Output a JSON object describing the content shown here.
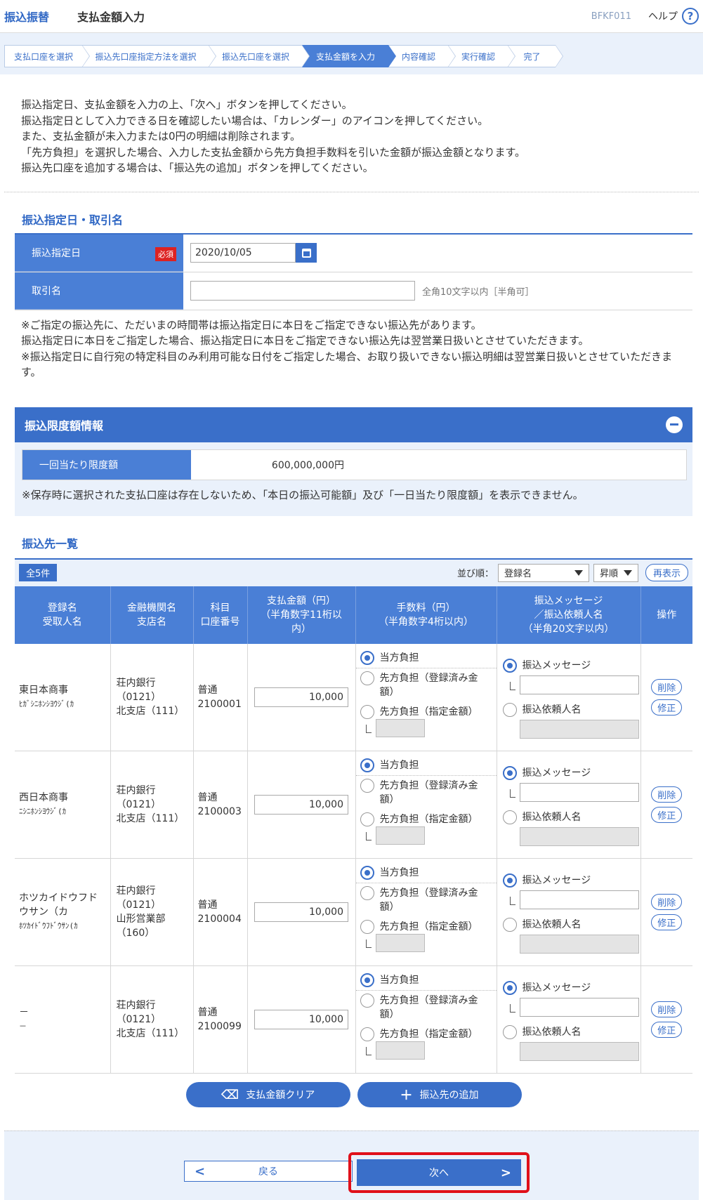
{
  "header": {
    "category": "振込振替",
    "title": "支払金額入力",
    "screen_code": "BFKF011",
    "help_label": "ヘルプ"
  },
  "steps": [
    "支払口座を選択",
    "振込先口座指定方法を選択",
    "振込先口座を選択",
    "支払金額を入力",
    "内容確認",
    "実行確認",
    "完了"
  ],
  "intro": [
    "振込指定日、支払金額を入力の上、「次へ」ボタンを押してください。",
    "振込指定日として入力できる日を確認したい場合は、「カレンダー」のアイコンを押してください。",
    "また、支払金額が未入力または0円の明細は削除されます。",
    "「先方負担」を選択した場合、入力した支払金額から先方負担手数料を引いた金額が振込金額となります。",
    "振込先口座を追加する場合は、「振込先の追加」ボタンを押してください。"
  ],
  "date_section": {
    "title": "振込指定日・取引名",
    "date_label": "振込指定日",
    "required": "必須",
    "date_value": "2020/10/05",
    "name_label": "取引名",
    "name_hint": "全角10文字以内［半角可］",
    "notes": [
      "※ご指定の振込先に、ただいまの時間帯は振込指定日に本日をご指定できない振込先があります。",
      "振込指定日に本日をご指定した場合、振込指定日に本日をご指定できない振込先は翌営業日扱いとさせていただきます。",
      "※振込指定日に自行宛の特定科目のみ利用可能な日付をご指定した場合、お取り扱いできない振込明細は翌営業日扱いとさせていただきます。"
    ]
  },
  "limit": {
    "title": "振込限度額情報",
    "label": "一回当たり限度額",
    "value": "600,000,000円",
    "note": "※保存時に選択された支払口座は存在しないため、「本日の振込可能額」及び「一日当たり限度額」を表示できません。"
  },
  "list": {
    "title": "振込先一覧",
    "count": "全5件",
    "sort_label": "並び順：",
    "sort_value": "登録名",
    "order_value": "昇順",
    "redisplay": "再表示",
    "headers": {
      "name1": "登録名",
      "name2": "受取人名",
      "bank1": "金融機関名",
      "bank2": "支店名",
      "acct1": "科目",
      "acct2": "口座番号",
      "amt1": "支払金額（円）",
      "amt2": "（半角数字11桁以",
      "amt3": "内）",
      "fee1": "手数料（円）",
      "fee2": "（半角数字4桁以内）",
      "msg1": "振込メッセージ",
      "msg2": "／振込依頼人名",
      "msg3": "（半角20文字以内）",
      "ops": "操作"
    },
    "fee_options": {
      "ours": "当方負担",
      "theirs_reg1": "先方負担（登録済み金",
      "theirs_reg2": "額）",
      "theirs_spec": "先方負担（指定金額）"
    },
    "msg_options": {
      "message": "振込メッセージ",
      "requester": "振込依頼人名"
    },
    "delete": "削除",
    "edit": "修正",
    "rows": [
      {
        "name1": "東日本商事",
        "name2": "ﾋｶﾞｼﾆﾎﾝｼﾖｳｼﾞ(ｶ",
        "name3": "",
        "bank1": "荘内銀行",
        "bank2": "（0121）",
        "bank3": "北支店（111）",
        "bank4": "",
        "acct1": "普通",
        "acct2": "2100001",
        "amount": "10,000"
      },
      {
        "name1": "西日本商事",
        "name2": "ﾆｼﾆﾎﾝｼﾖｳｼﾞ(ｶ",
        "name3": "",
        "bank1": "荘内銀行",
        "bank2": "（0121）",
        "bank3": "北支店（111）",
        "bank4": "",
        "acct1": "普通",
        "acct2": "2100003",
        "amount": "10,000"
      },
      {
        "name1": "ホツカイドウフド",
        "name2": "ウサン（カ",
        "name3": "ﾎﾂｶｲﾄﾞｳﾌﾄﾞｳｻﾝ(ｶ",
        "bank1": "荘内銀行",
        "bank2": "（0121）",
        "bank3": "山形営業部",
        "bank4": "（160）",
        "acct1": "普通",
        "acct2": "2100004",
        "amount": "10,000"
      },
      {
        "name1": "－",
        "name2": "－",
        "name3": "",
        "bank1": "荘内銀行",
        "bank2": "（0121）",
        "bank3": "北支店（111）",
        "bank4": "",
        "acct1": "普通",
        "acct2": "2100099",
        "amount": "10,000"
      }
    ],
    "clear_button": "支払金額クリア",
    "add_button": "振込先の追加"
  },
  "footer": {
    "back": "戻る",
    "next": "次へ"
  }
}
